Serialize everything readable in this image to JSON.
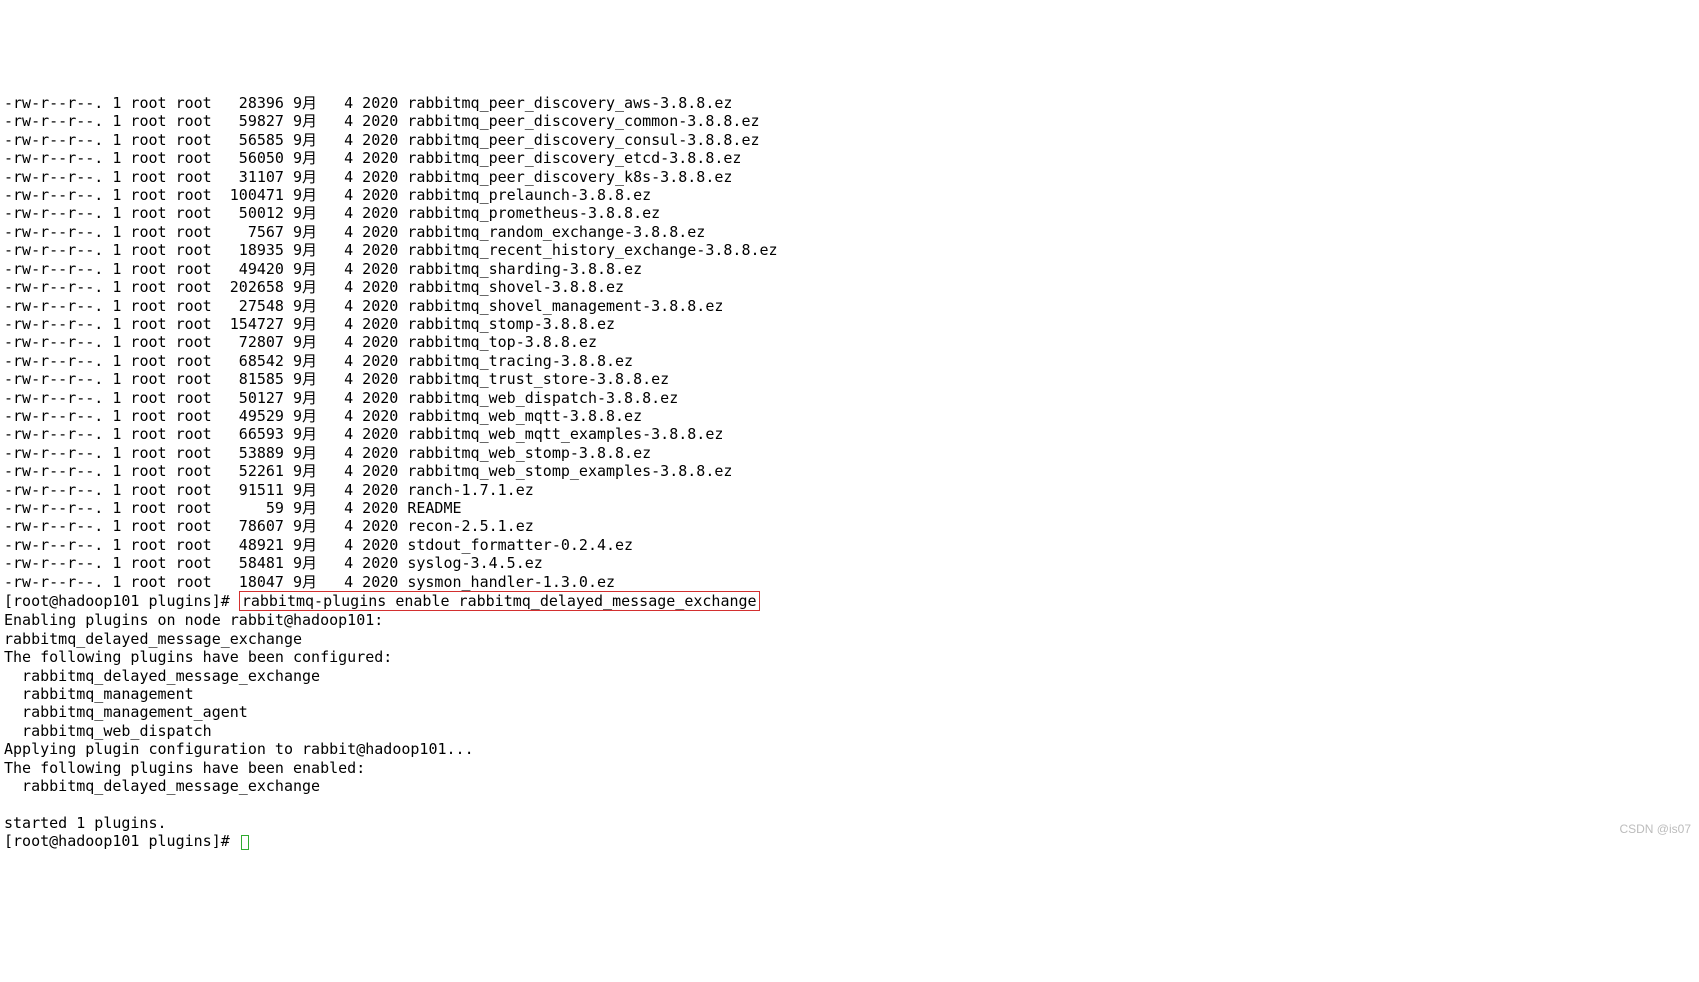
{
  "listing": [
    {
      "perms": "-rw-r--r--.",
      "links": "1",
      "owner": "root",
      "group": "root",
      "size": "28396",
      "month": "9月",
      "day": "4",
      "year": "2020",
      "name": "rabbitmq_peer_discovery_aws-3.8.8.ez"
    },
    {
      "perms": "-rw-r--r--.",
      "links": "1",
      "owner": "root",
      "group": "root",
      "size": "59827",
      "month": "9月",
      "day": "4",
      "year": "2020",
      "name": "rabbitmq_peer_discovery_common-3.8.8.ez"
    },
    {
      "perms": "-rw-r--r--.",
      "links": "1",
      "owner": "root",
      "group": "root",
      "size": "56585",
      "month": "9月",
      "day": "4",
      "year": "2020",
      "name": "rabbitmq_peer_discovery_consul-3.8.8.ez"
    },
    {
      "perms": "-rw-r--r--.",
      "links": "1",
      "owner": "root",
      "group": "root",
      "size": "56050",
      "month": "9月",
      "day": "4",
      "year": "2020",
      "name": "rabbitmq_peer_discovery_etcd-3.8.8.ez"
    },
    {
      "perms": "-rw-r--r--.",
      "links": "1",
      "owner": "root",
      "group": "root",
      "size": "31107",
      "month": "9月",
      "day": "4",
      "year": "2020",
      "name": "rabbitmq_peer_discovery_k8s-3.8.8.ez"
    },
    {
      "perms": "-rw-r--r--.",
      "links": "1",
      "owner": "root",
      "group": "root",
      "size": "100471",
      "month": "9月",
      "day": "4",
      "year": "2020",
      "name": "rabbitmq_prelaunch-3.8.8.ez"
    },
    {
      "perms": "-rw-r--r--.",
      "links": "1",
      "owner": "root",
      "group": "root",
      "size": "50012",
      "month": "9月",
      "day": "4",
      "year": "2020",
      "name": "rabbitmq_prometheus-3.8.8.ez"
    },
    {
      "perms": "-rw-r--r--.",
      "links": "1",
      "owner": "root",
      "group": "root",
      "size": "7567",
      "month": "9月",
      "day": "4",
      "year": "2020",
      "name": "rabbitmq_random_exchange-3.8.8.ez"
    },
    {
      "perms": "-rw-r--r--.",
      "links": "1",
      "owner": "root",
      "group": "root",
      "size": "18935",
      "month": "9月",
      "day": "4",
      "year": "2020",
      "name": "rabbitmq_recent_history_exchange-3.8.8.ez"
    },
    {
      "perms": "-rw-r--r--.",
      "links": "1",
      "owner": "root",
      "group": "root",
      "size": "49420",
      "month": "9月",
      "day": "4",
      "year": "2020",
      "name": "rabbitmq_sharding-3.8.8.ez"
    },
    {
      "perms": "-rw-r--r--.",
      "links": "1",
      "owner": "root",
      "group": "root",
      "size": "202658",
      "month": "9月",
      "day": "4",
      "year": "2020",
      "name": "rabbitmq_shovel-3.8.8.ez"
    },
    {
      "perms": "-rw-r--r--.",
      "links": "1",
      "owner": "root",
      "group": "root",
      "size": "27548",
      "month": "9月",
      "day": "4",
      "year": "2020",
      "name": "rabbitmq_shovel_management-3.8.8.ez"
    },
    {
      "perms": "-rw-r--r--.",
      "links": "1",
      "owner": "root",
      "group": "root",
      "size": "154727",
      "month": "9月",
      "day": "4",
      "year": "2020",
      "name": "rabbitmq_stomp-3.8.8.ez"
    },
    {
      "perms": "-rw-r--r--.",
      "links": "1",
      "owner": "root",
      "group": "root",
      "size": "72807",
      "month": "9月",
      "day": "4",
      "year": "2020",
      "name": "rabbitmq_top-3.8.8.ez"
    },
    {
      "perms": "-rw-r--r--.",
      "links": "1",
      "owner": "root",
      "group": "root",
      "size": "68542",
      "month": "9月",
      "day": "4",
      "year": "2020",
      "name": "rabbitmq_tracing-3.8.8.ez"
    },
    {
      "perms": "-rw-r--r--.",
      "links": "1",
      "owner": "root",
      "group": "root",
      "size": "81585",
      "month": "9月",
      "day": "4",
      "year": "2020",
      "name": "rabbitmq_trust_store-3.8.8.ez"
    },
    {
      "perms": "-rw-r--r--.",
      "links": "1",
      "owner": "root",
      "group": "root",
      "size": "50127",
      "month": "9月",
      "day": "4",
      "year": "2020",
      "name": "rabbitmq_web_dispatch-3.8.8.ez"
    },
    {
      "perms": "-rw-r--r--.",
      "links": "1",
      "owner": "root",
      "group": "root",
      "size": "49529",
      "month": "9月",
      "day": "4",
      "year": "2020",
      "name": "rabbitmq_web_mqtt-3.8.8.ez"
    },
    {
      "perms": "-rw-r--r--.",
      "links": "1",
      "owner": "root",
      "group": "root",
      "size": "66593",
      "month": "9月",
      "day": "4",
      "year": "2020",
      "name": "rabbitmq_web_mqtt_examples-3.8.8.ez"
    },
    {
      "perms": "-rw-r--r--.",
      "links": "1",
      "owner": "root",
      "group": "root",
      "size": "53889",
      "month": "9月",
      "day": "4",
      "year": "2020",
      "name": "rabbitmq_web_stomp-3.8.8.ez"
    },
    {
      "perms": "-rw-r--r--.",
      "links": "1",
      "owner": "root",
      "group": "root",
      "size": "52261",
      "month": "9月",
      "day": "4",
      "year": "2020",
      "name": "rabbitmq_web_stomp_examples-3.8.8.ez"
    },
    {
      "perms": "-rw-r--r--.",
      "links": "1",
      "owner": "root",
      "group": "root",
      "size": "91511",
      "month": "9月",
      "day": "4",
      "year": "2020",
      "name": "ranch-1.7.1.ez"
    },
    {
      "perms": "-rw-r--r--.",
      "links": "1",
      "owner": "root",
      "group": "root",
      "size": "59",
      "month": "9月",
      "day": "4",
      "year": "2020",
      "name": "README"
    },
    {
      "perms": "-rw-r--r--.",
      "links": "1",
      "owner": "root",
      "group": "root",
      "size": "78607",
      "month": "9月",
      "day": "4",
      "year": "2020",
      "name": "recon-2.5.1.ez"
    },
    {
      "perms": "-rw-r--r--.",
      "links": "1",
      "owner": "root",
      "group": "root",
      "size": "48921",
      "month": "9月",
      "day": "4",
      "year": "2020",
      "name": "stdout_formatter-0.2.4.ez"
    },
    {
      "perms": "-rw-r--r--.",
      "links": "1",
      "owner": "root",
      "group": "root",
      "size": "58481",
      "month": "9月",
      "day": "4",
      "year": "2020",
      "name": "syslog-3.4.5.ez"
    },
    {
      "perms": "-rw-r--r--.",
      "links": "1",
      "owner": "root",
      "group": "root",
      "size": "18047",
      "month": "9月",
      "day": "4",
      "year": "2020",
      "name": "sysmon_handler-1.3.0.ez"
    }
  ],
  "prompt1": "[root@hadoop101 plugins]# ",
  "command": "rabbitmq-plugins enable rabbitmq_delayed_message_exchange",
  "output_lines": [
    "Enabling plugins on node rabbit@hadoop101:",
    "rabbitmq_delayed_message_exchange",
    "The following plugins have been configured:",
    "  rabbitmq_delayed_message_exchange",
    "  rabbitmq_management",
    "  rabbitmq_management_agent",
    "  rabbitmq_web_dispatch",
    "Applying plugin configuration to rabbit@hadoop101...",
    "The following plugins have been enabled:",
    "  rabbitmq_delayed_message_exchange",
    "",
    "started 1 plugins."
  ],
  "prompt2": "[root@hadoop101 plugins]# ",
  "watermark": "CSDN @is07"
}
